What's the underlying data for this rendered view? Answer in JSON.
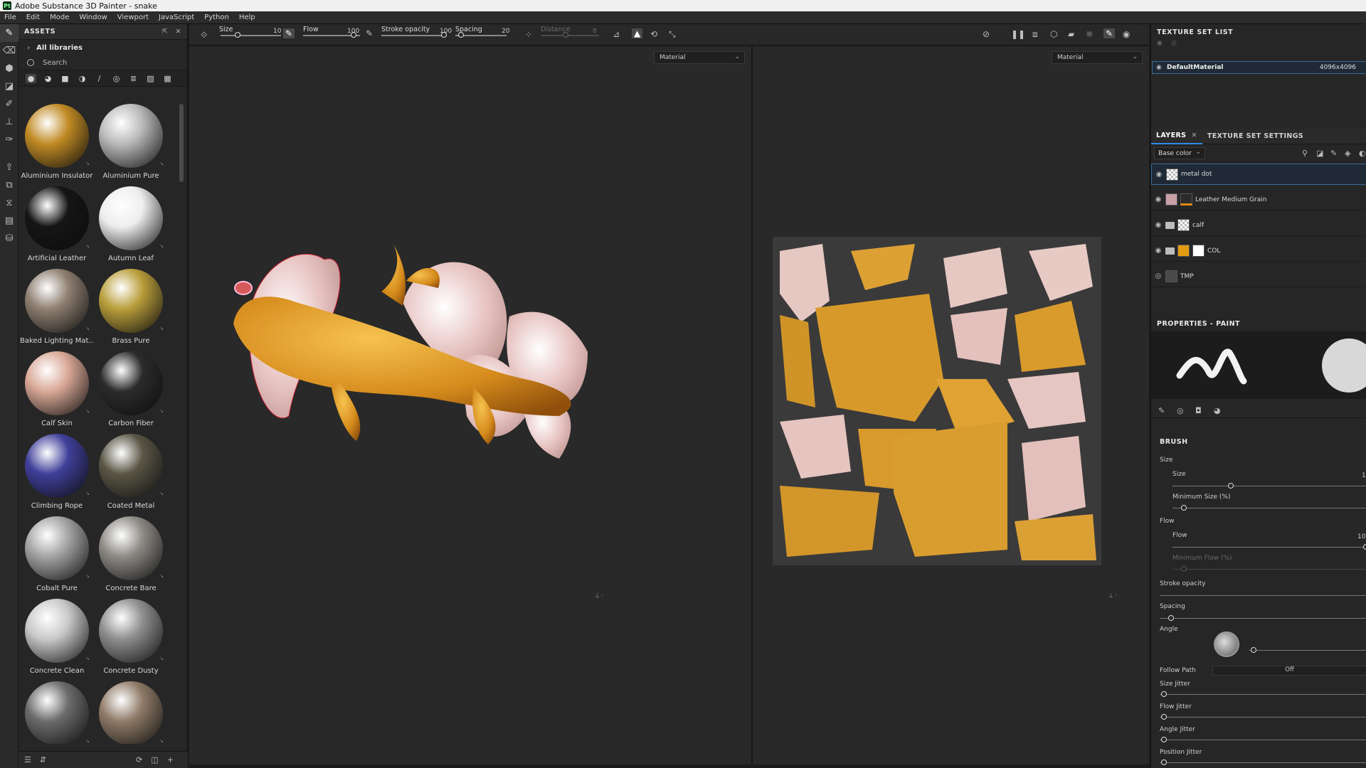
{
  "window": {
    "title": "Adobe Substance 3D Painter - snake",
    "logo": "Pt"
  },
  "menu": [
    "File",
    "Edit",
    "Mode",
    "Window",
    "Viewport",
    "JavaScript",
    "Python",
    "Help"
  ],
  "assets": {
    "title": "ASSETS",
    "library": "All libraries",
    "search_placeholder": "Search",
    "materials": [
      {
        "name": "Aluminium Insulator",
        "color": "#c08a24"
      },
      {
        "name": "Aluminium Pure",
        "color": "#b9b9b9"
      },
      {
        "name": "Artificial Leather",
        "color": "#151515"
      },
      {
        "name": "Autumn Leaf",
        "color": "#efeeee"
      },
      {
        "name": "Baked Lighting Mat...",
        "color": "#8e7f71"
      },
      {
        "name": "Brass Pure",
        "color": "#b99e3b"
      },
      {
        "name": "Calf Skin",
        "color": "#d9a897"
      },
      {
        "name": "Carbon Fiber",
        "color": "#2b2b2b"
      },
      {
        "name": "Climbing Rope",
        "color": "#3f3f9a"
      },
      {
        "name": "Coated Metal",
        "color": "#5a5646"
      },
      {
        "name": "Cobalt Pure",
        "color": "#a4a4a4"
      },
      {
        "name": "Concrete Bare",
        "color": "#8e8b86"
      },
      {
        "name": "Concrete Clean",
        "color": "#c9c9c9"
      },
      {
        "name": "Concrete Dusty",
        "color": "#8f8f8f"
      },
      {
        "name": "",
        "color": "#6b6b6b"
      },
      {
        "name": "",
        "color": "#8f7b68"
      }
    ]
  },
  "toolbar": {
    "size_label": "Size",
    "size_value": "10",
    "flow_label": "Flow",
    "flow_value": "100",
    "opacity_label": "Stroke opacity",
    "opacity_value": "100",
    "spacing_label": "Spacing",
    "spacing_value": "20",
    "distance_label": "Distance",
    "distance_value": "8"
  },
  "viewports": {
    "left_mode": "Material",
    "right_mode": "Material"
  },
  "texture_set_list": {
    "title": "TEXTURE SET LIST",
    "set_name": "DefaultMaterial",
    "resolution": "4096x4096"
  },
  "layers_panel": {
    "tab_layers": "LAYERS",
    "tab_settings": "TEXTURE SET SETTINGS",
    "channel": "Base color",
    "layers": [
      {
        "name": "metal dot"
      },
      {
        "name": "Leather Medium Grain"
      },
      {
        "name": "calf"
      },
      {
        "name": "COL"
      },
      {
        "name": "TMP"
      }
    ]
  },
  "properties": {
    "title": "PROPERTIES - PAINT",
    "section": "BRUSH",
    "size_group": "Size",
    "size": "Size",
    "min_size": "Minimum Size (%)",
    "flow_group": "Flow",
    "flow": "Flow",
    "min_flow": "Minimum Flow (%)",
    "stroke_opacity": "Stroke opacity",
    "spacing": "Spacing",
    "angle": "Angle",
    "follow_path": "Follow Path",
    "follow_path_value": "Off",
    "size_jitter": "Size Jitter",
    "flow_jitter": "Flow Jitter",
    "angle_jitter": "Angle Jitter",
    "position_jitter": "Position Jitter",
    "size_value": "1",
    "flow_value": "10"
  },
  "colors": {
    "accent": "#2d8ce6",
    "selection": "#1f2a36",
    "creature": "#e2a430",
    "fin": "#e9c6c4"
  }
}
